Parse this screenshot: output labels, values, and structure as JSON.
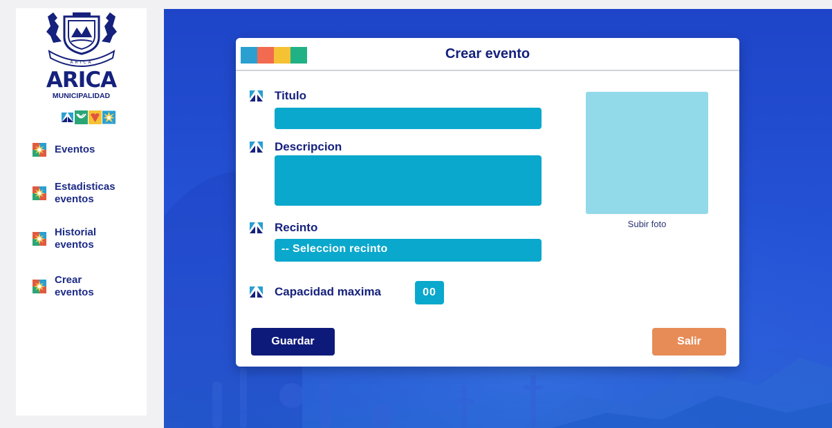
{
  "brand": {
    "name": "ARICA",
    "subtitle": "MUNICIPALIDAD",
    "crest_ribbon": "ARICA",
    "colors": {
      "navy": "#15217c",
      "cyan": "#0aa8cc",
      "orange": "#e78c57"
    }
  },
  "sidebar": {
    "items": [
      {
        "label": "Eventos",
        "icon": "sun-tile-icon"
      },
      {
        "label": "Estadisticas\neventos",
        "icon": "sun-tile-icon"
      },
      {
        "label": "Historial\neventos",
        "icon": "sun-tile-icon"
      },
      {
        "label": "Crear\neventos",
        "icon": "sun-tile-icon"
      }
    ]
  },
  "form": {
    "title": "Crear evento",
    "fields": {
      "titulo": {
        "label": "Titulo",
        "value": ""
      },
      "descripcion": {
        "label": "Descripcion",
        "value": ""
      },
      "recinto": {
        "label": "Recinto",
        "selected": "-- Seleccion recinto"
      },
      "capacidad": {
        "label": "Capacidad maxima",
        "value": "00"
      }
    },
    "photo_label": "Subir foto",
    "save_label": "Guardar",
    "exit_label": "Salir"
  }
}
